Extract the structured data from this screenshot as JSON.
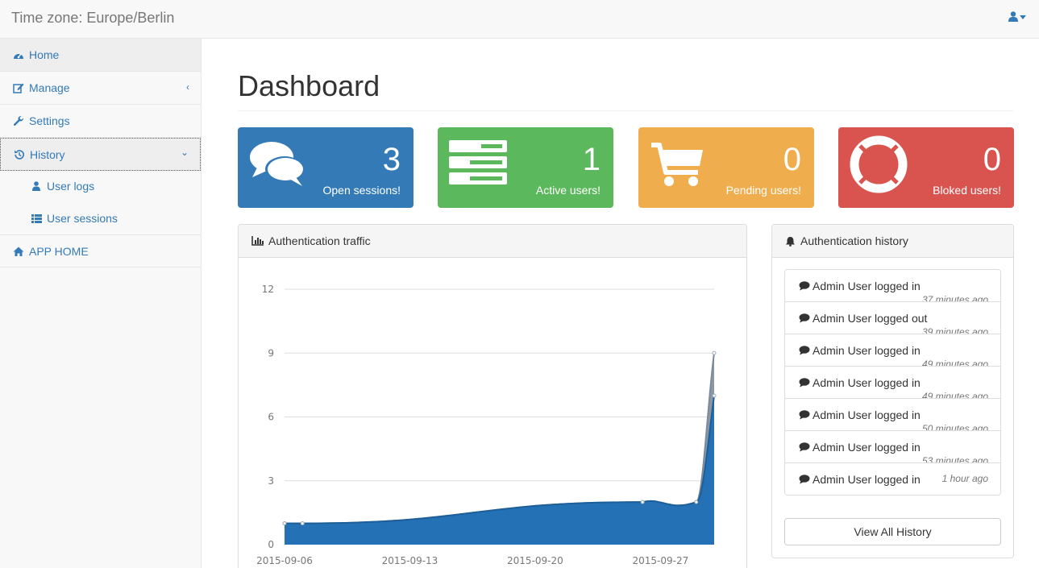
{
  "header": {
    "brand": "Time zone: Europe/Berlin",
    "user_icon": "user-icon"
  },
  "sidebar": {
    "items": [
      {
        "label": "Home",
        "icon": "dashboard-icon"
      },
      {
        "label": "Manage",
        "icon": "edit-icon",
        "chevron": "‹"
      },
      {
        "label": "Settings",
        "icon": "wrench-icon"
      },
      {
        "label": "History",
        "icon": "history-icon",
        "chevron": "⌄"
      },
      {
        "label": "APP HOME",
        "icon": "home-icon"
      }
    ],
    "subitems": [
      {
        "label": "User logs",
        "icon": "user-icon"
      },
      {
        "label": "User sessions",
        "icon": "list-icon"
      }
    ]
  },
  "page": {
    "title": "Dashboard"
  },
  "stats": [
    {
      "value": "3",
      "label": "Open sessions!",
      "color": "#337ab7",
      "icon": "comments-icon"
    },
    {
      "value": "1",
      "label": "Active users!",
      "color": "#5cb85c",
      "icon": "server-icon"
    },
    {
      "value": "0",
      "label": "Pending users!",
      "color": "#f0ad4e",
      "icon": "cart-icon"
    },
    {
      "value": "0",
      "label": "Bloked users!",
      "color": "#d9534f",
      "icon": "life-ring-icon"
    }
  ],
  "traffic": {
    "title": "Authentication traffic",
    "icon": "bar-chart-icon"
  },
  "history": {
    "title": "Authentication history",
    "icon": "bell-icon",
    "items": [
      {
        "text": "Admin User logged in",
        "ago": "37 minutes ago"
      },
      {
        "text": "Admin User logged out",
        "ago": "39 minutes ago"
      },
      {
        "text": "Admin User logged in",
        "ago": "49 minutes ago"
      },
      {
        "text": "Admin User logged in",
        "ago": "49 minutes ago"
      },
      {
        "text": "Admin User logged in",
        "ago": "50 minutes ago"
      },
      {
        "text": "Admin User logged in",
        "ago": "53 minutes ago"
      },
      {
        "text": "Admin User logged in",
        "ago": "1 hour ago"
      }
    ],
    "view_all": "View All History"
  },
  "chart_data": {
    "type": "area",
    "x": [
      "2015-09-06",
      "2015-09-07",
      "2015-09-26",
      "2015-09-29",
      "2015-09-30"
    ],
    "xticks": [
      "2015-09-06",
      "2015-09-13",
      "2015-09-20",
      "2015-09-27"
    ],
    "ylim": [
      0,
      12
    ],
    "yticks": [
      0,
      3,
      6,
      9,
      12
    ],
    "grid": true,
    "series": [
      {
        "values": [
          1,
          1,
          2,
          2,
          9
        ],
        "color": "#8a97a5"
      },
      {
        "values": [
          1,
          1,
          2,
          2,
          7
        ],
        "color": "#2571b5"
      }
    ]
  }
}
